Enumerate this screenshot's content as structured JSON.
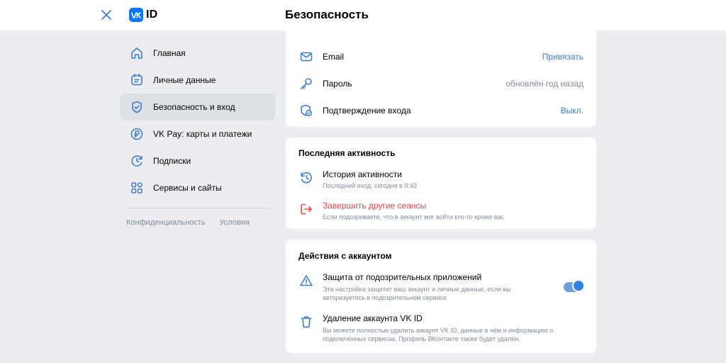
{
  "header": {
    "logo_text": "ID",
    "logo_badge": "VK",
    "page_title": "Безопасность"
  },
  "sidebar": {
    "items": [
      {
        "label": "Главная",
        "icon": "home-icon"
      },
      {
        "label": "Личные данные",
        "icon": "profile-card-icon"
      },
      {
        "label": "Безопасность и вход",
        "icon": "shield-icon",
        "active": true
      },
      {
        "label": "VK Pay: карты и платежи",
        "icon": "ruble-icon"
      },
      {
        "label": "Подписки",
        "icon": "subscription-icon"
      },
      {
        "label": "Сервисы и сайты",
        "icon": "services-grid-icon"
      }
    ],
    "footer": {
      "privacy": "Конфиденциальность",
      "terms": "Условия"
    }
  },
  "login_card": {
    "email": {
      "label": "Email",
      "value": "Привязать"
    },
    "password": {
      "label": "Пароль",
      "value": "обновлён год назад"
    },
    "confirmation": {
      "label": "Подтверждение входа",
      "value": "Выкл."
    }
  },
  "activity_card": {
    "title": "Последняя активность",
    "history": {
      "title": "История активности",
      "subtitle": "Последний вход: сегодня в 9:43"
    },
    "sessions": {
      "title": "Завершить другие сеансы",
      "subtitle": "Если подозреваете, что в аккаунт мог войти кто-то кроме вас"
    }
  },
  "actions_card": {
    "title": "Действия с аккаунтом",
    "protection": {
      "title": "Защита от подозрительных приложений",
      "subtitle_line1": "Эта настройка защитит ваш аккаунт и личные данные, если вы",
      "subtitle_line2": "авторизуетесь в подозрительном сервисе",
      "enabled": true
    },
    "delete": {
      "title": "Удаление аккаунта VK ID",
      "subtitle_line1": "Вы можете полностью удалить аккаунт VK ID, данные в нём и информацию о",
      "subtitle_line2": "подключённых сервисах. Профиль ВКонтакте также будет удалён."
    }
  },
  "colors": {
    "accent": "#0077ff",
    "icon_blue": "#3f7ec7",
    "danger": "#e64646",
    "muted": "#818c99"
  }
}
